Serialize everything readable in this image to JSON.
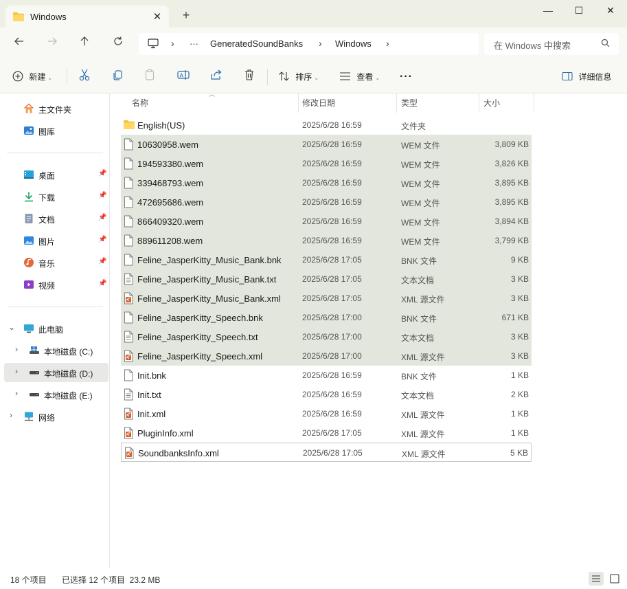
{
  "window": {
    "tab_title": "Windows",
    "tab_close": "✕",
    "new_tab": "+",
    "minimize": "—",
    "maximize": "☐",
    "close": "✕"
  },
  "address": {
    "more": "···",
    "segments": [
      "GeneratedSoundBanks",
      "Windows"
    ],
    "separator": "›"
  },
  "search": {
    "placeholder": "在 Windows 中搜索"
  },
  "toolbar": {
    "new_label": "新建",
    "sort_label": "排序",
    "view_label": "查看",
    "more": "···",
    "details_label": "详细信息"
  },
  "sidebar": {
    "home": "主文件夹",
    "gallery": "图库",
    "pinned": [
      {
        "label": "桌面",
        "icon": "desktop-icon"
      },
      {
        "label": "下载",
        "icon": "download-icon"
      },
      {
        "label": "文档",
        "icon": "document-icon"
      },
      {
        "label": "图片",
        "icon": "picture-icon"
      },
      {
        "label": "音乐",
        "icon": "music-icon"
      },
      {
        "label": "视频",
        "icon": "video-icon"
      }
    ],
    "this_pc": "此电脑",
    "drives": [
      "本地磁盘 (C:)",
      "本地磁盘 (D:)",
      "本地磁盘 (E:)"
    ],
    "network": "网络"
  },
  "columns": {
    "name": "名称",
    "date": "修改日期",
    "type": "类型",
    "size": "大小"
  },
  "files": [
    {
      "name": "English(US)",
      "date": "2025/6/28 16:59",
      "type": "文件夹",
      "size": "",
      "kind": "folder",
      "selected": false
    },
    {
      "name": "10630958.wem",
      "date": "2025/6/28 16:59",
      "type": "WEM 文件",
      "size": "3,809 KB",
      "kind": "file",
      "selected": true
    },
    {
      "name": "194593380.wem",
      "date": "2025/6/28 16:59",
      "type": "WEM 文件",
      "size": "3,826 KB",
      "kind": "file",
      "selected": true
    },
    {
      "name": "339468793.wem",
      "date": "2025/6/28 16:59",
      "type": "WEM 文件",
      "size": "3,895 KB",
      "kind": "file",
      "selected": true
    },
    {
      "name": "472695686.wem",
      "date": "2025/6/28 16:59",
      "type": "WEM 文件",
      "size": "3,895 KB",
      "kind": "file",
      "selected": true
    },
    {
      "name": "866409320.wem",
      "date": "2025/6/28 16:59",
      "type": "WEM 文件",
      "size": "3,894 KB",
      "kind": "file",
      "selected": true
    },
    {
      "name": "889611208.wem",
      "date": "2025/6/28 16:59",
      "type": "WEM 文件",
      "size": "3,799 KB",
      "kind": "file",
      "selected": true
    },
    {
      "name": "Feline_JasperKitty_Music_Bank.bnk",
      "date": "2025/6/28 17:05",
      "type": "BNK 文件",
      "size": "9 KB",
      "kind": "file",
      "selected": true
    },
    {
      "name": "Feline_JasperKitty_Music_Bank.txt",
      "date": "2025/6/28 17:05",
      "type": "文本文档",
      "size": "3 KB",
      "kind": "text",
      "selected": true
    },
    {
      "name": "Feline_JasperKitty_Music_Bank.xml",
      "date": "2025/6/28 17:05",
      "type": "XML 源文件",
      "size": "3 KB",
      "kind": "xml",
      "selected": true
    },
    {
      "name": "Feline_JasperKitty_Speech.bnk",
      "date": "2025/6/28 17:00",
      "type": "BNK 文件",
      "size": "671 KB",
      "kind": "file",
      "selected": true
    },
    {
      "name": "Feline_JasperKitty_Speech.txt",
      "date": "2025/6/28 17:00",
      "type": "文本文档",
      "size": "3 KB",
      "kind": "text",
      "selected": true
    },
    {
      "name": "Feline_JasperKitty_Speech.xml",
      "date": "2025/6/28 17:00",
      "type": "XML 源文件",
      "size": "3 KB",
      "kind": "xml",
      "selected": true
    },
    {
      "name": "Init.bnk",
      "date": "2025/6/28 16:59",
      "type": "BNK 文件",
      "size": "1 KB",
      "kind": "file",
      "selected": false
    },
    {
      "name": "Init.txt",
      "date": "2025/6/28 16:59",
      "type": "文本文档",
      "size": "2 KB",
      "kind": "text",
      "selected": false
    },
    {
      "name": "Init.xml",
      "date": "2025/6/28 16:59",
      "type": "XML 源文件",
      "size": "1 KB",
      "kind": "xml",
      "selected": false
    },
    {
      "name": "PluginInfo.xml",
      "date": "2025/6/28 17:05",
      "type": "XML 源文件",
      "size": "1 KB",
      "kind": "xml",
      "selected": false
    },
    {
      "name": "SoundbanksInfo.xml",
      "date": "2025/6/28 17:05",
      "type": "XML 源文件",
      "size": "5 KB",
      "kind": "xml",
      "selected": false,
      "focused": true
    }
  ],
  "status": {
    "count": "18 个项目",
    "selection": "已选择 12 个项目  23.2 MB"
  },
  "colors": {
    "selection": "#e2e6dc",
    "titlebar": "#eef0e6",
    "toolbar": "#f8f9f4",
    "folder": "#f5c342",
    "xml_accent": "#d9622b"
  }
}
